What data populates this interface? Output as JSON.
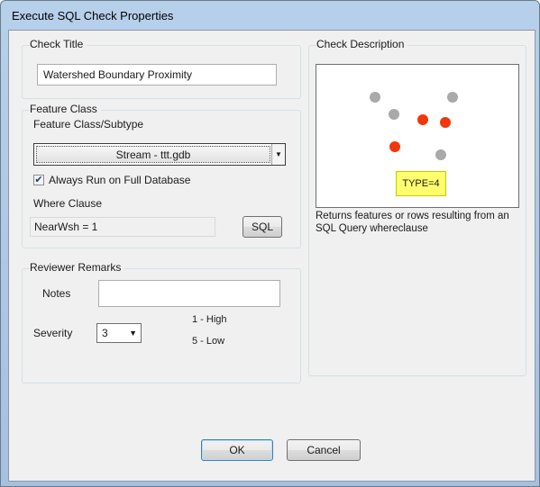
{
  "window": {
    "title": "Execute SQL Check Properties"
  },
  "check_title": {
    "group_label": "Check Title",
    "value": "Watershed Boundary Proximity"
  },
  "feature_class": {
    "group_label": "Feature Class",
    "subtype_label": "Feature Class/Subtype",
    "selected": "Stream -  ttt.gdb",
    "always_run_label": "Always Run on Full Database",
    "always_run_checked": true,
    "where_label": "Where Clause",
    "where_value": "NearWsh = 1",
    "sql_button": "SQL"
  },
  "reviewer_remarks": {
    "group_label": "Reviewer Remarks",
    "notes_label": "Notes",
    "notes_value": "",
    "severity_label": "Severity",
    "severity_value": "3",
    "severity_high": "1 - High",
    "severity_low": "5 - Low"
  },
  "check_description": {
    "group_label": "Check Description",
    "badge": "TYPE=4",
    "text": "Returns features or rows resulting from an SQL Query whereclause",
    "dot_colors": {
      "gray": "#a9a9a9",
      "red": "#f0380c"
    }
  },
  "buttons": {
    "ok": "OK",
    "cancel": "Cancel"
  }
}
